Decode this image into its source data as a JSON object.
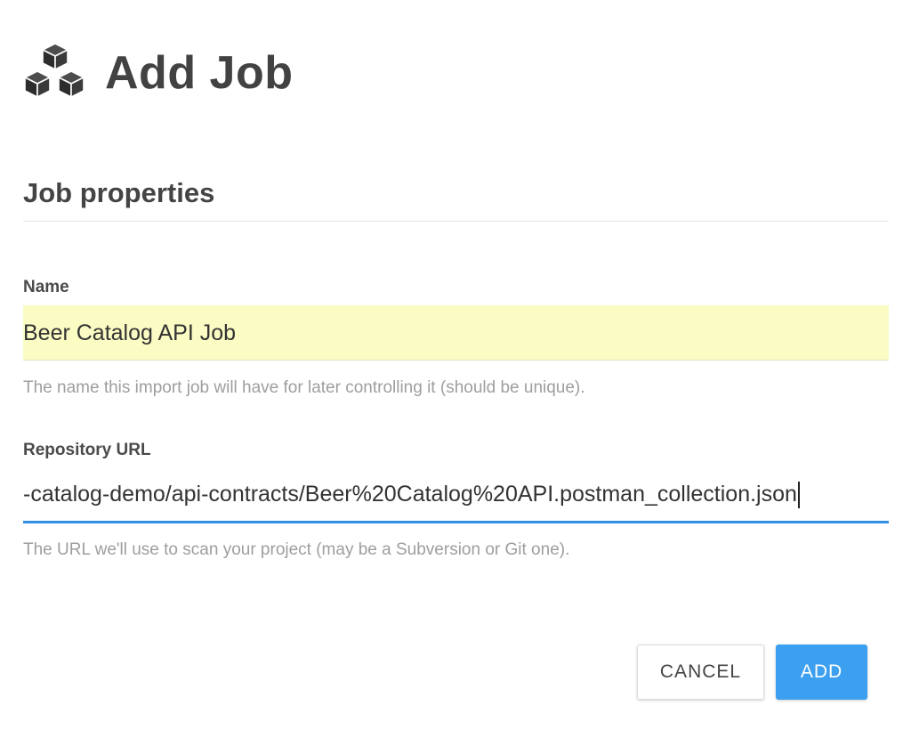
{
  "dialog": {
    "title": "Add Job",
    "title_icon": "cubes-icon"
  },
  "section": {
    "title": "Job properties"
  },
  "fields": {
    "name": {
      "label": "Name",
      "value": "Beer Catalog API Job",
      "help": "The name this import job will have for later controlling it (should be unique).",
      "background": "#fafcc3"
    },
    "repository_url": {
      "label": "Repository URL",
      "value": "-catalog-demo/api-contracts/Beer%20Catalog%20API.postman_collection.json",
      "help": "The URL we'll use to scan your project (may be a Subversion or Git one).",
      "focus_color": "#2f8ee5"
    }
  },
  "buttons": {
    "cancel": "CANCEL",
    "add": "ADD",
    "add_color": "#3d9ff0"
  }
}
